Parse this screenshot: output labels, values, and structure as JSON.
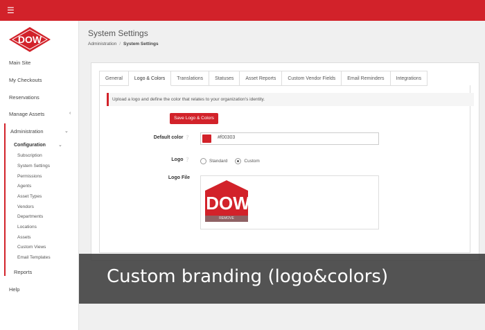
{
  "app": {
    "accent_color": "#d2222a",
    "menu_icon": "hamburger-icon",
    "logo_text": "DOW"
  },
  "sidebar": {
    "items": [
      {
        "label": "Main Site"
      },
      {
        "label": "My Checkouts"
      },
      {
        "label": "Reservations"
      },
      {
        "label": "Manage Assets",
        "icon": "chevron-left-icon"
      },
      {
        "label": "Administration",
        "icon": "chevron-down-icon"
      }
    ],
    "configuration": {
      "label": "Configuration",
      "icon": "chevron-down-icon"
    },
    "sub_items": [
      {
        "label": "Subscription"
      },
      {
        "label": "System Settings"
      },
      {
        "label": "Permissions"
      },
      {
        "label": "Agents"
      },
      {
        "label": "Asset Types"
      },
      {
        "label": "Vendors"
      },
      {
        "label": "Departments"
      },
      {
        "label": "Locations"
      },
      {
        "label": "Assets"
      },
      {
        "label": "Custom Views"
      }
    ],
    "overlayed_items": [
      {
        "label": "Email Templates"
      },
      {
        "label": "Reports"
      },
      {
        "label": "Help"
      }
    ]
  },
  "header": {
    "title": "System Settings",
    "breadcrumb": [
      "Administration",
      "System Settings"
    ],
    "breadcrumb_sep": "/"
  },
  "tabs": [
    {
      "label": "General"
    },
    {
      "label": "Logo & Colors",
      "active": true
    },
    {
      "label": "Translations"
    },
    {
      "label": "Statuses"
    },
    {
      "label": "Asset Reports"
    },
    {
      "label": "Custom Vendor Fields"
    },
    {
      "label": "Email Reminders"
    },
    {
      "label": "Integrations"
    }
  ],
  "content": {
    "info": "Upload a logo and define the color that relates to your organization's identity.",
    "save_label": "Save Logo & Colors",
    "default_color_label": "Default color",
    "default_color_value": "#f00303",
    "swatch_color": "#d2222a",
    "logo_label": "Logo",
    "logo_options": [
      {
        "label": "Standard",
        "checked": false
      },
      {
        "label": "Custom",
        "checked": true
      }
    ],
    "logo_file_label": "Logo File",
    "logo_preview_text": "DOW",
    "remove_label": "REMOVE",
    "help_icon": "question-circle-icon"
  },
  "caption": "Custom branding (logo&colors)"
}
